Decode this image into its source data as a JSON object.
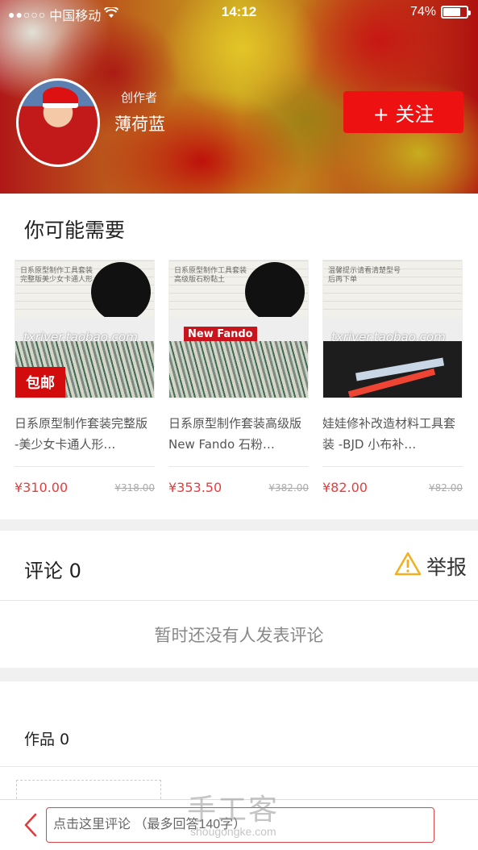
{
  "status_bar": {
    "carrier": "中国移动",
    "time": "14:12",
    "battery": "74%",
    "battery_level": 0.74
  },
  "profile": {
    "role_label": "创作者",
    "name": "薄荷蓝",
    "follow_label": "+ 关注"
  },
  "recommend": {
    "title": "你可能需要",
    "products": [
      {
        "name": "日系原型制作套装完整版 -美少女卡通人形…",
        "price": "¥310.00",
        "old_price": "¥318.00",
        "watermark": "txriver.taobao.com",
        "badge": "包邮"
      },
      {
        "name": "日系原型制作套装高级版 New Fando 石粉…",
        "price": "¥353.50",
        "old_price": "¥382.00",
        "label": "New Fando"
      },
      {
        "name": "娃娃修补改造材料工具套装 -BJD 小布补…",
        "price": "¥82.00",
        "old_price": "¥82.00",
        "watermark": "txriver.taobao.com"
      }
    ]
  },
  "comments": {
    "title": "评论 0",
    "report_label": "举报",
    "empty_text": "暂时还没有人发表评论"
  },
  "works": {
    "title": "作品 0"
  },
  "bottom_bar": {
    "placeholder": "点击这里评论 （最多回答140字）"
  },
  "watermark": {
    "zh": "手工客",
    "en": "shougongke.com"
  },
  "colors": {
    "accent": "#ee1111",
    "price": "#e83c3c",
    "warning": "#f0b020"
  }
}
